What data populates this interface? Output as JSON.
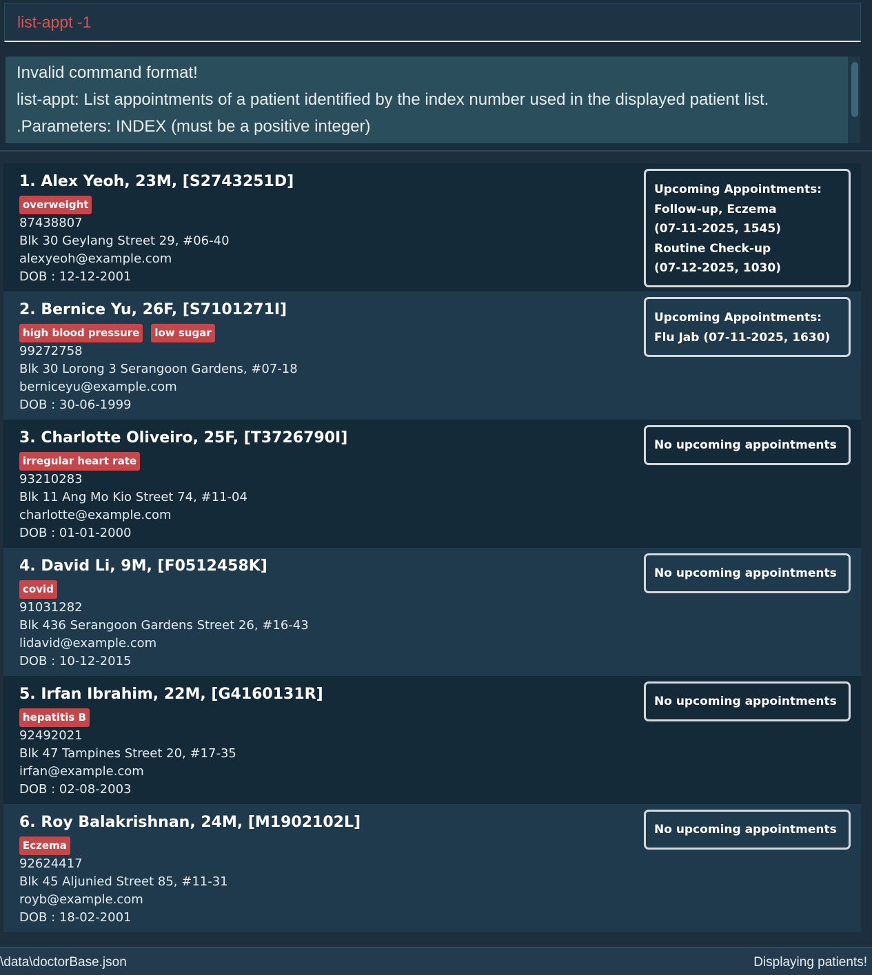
{
  "command": {
    "value": "list-appt -1"
  },
  "result": {
    "lines": [
      "Invalid command format!",
      "list-appt: List appointments of a patient identified by the index number used in the displayed patient list.",
      ".Parameters: INDEX (must be a positive integer)"
    ]
  },
  "patients": [
    {
      "name": "1. Alex Yeoh, 23M, [S2743251D]",
      "tags": [
        "overweight"
      ],
      "phone": "87438807",
      "address": "Blk 30 Geylang Street 29, #06-40",
      "email": "alexyeoh@example.com",
      "dob": "DOB : 12-12-2001",
      "appointments": [
        "Upcoming Appointments:",
        "Follow-up, Eczema",
        "(07-11-2025, 1545)",
        "Routine Check-up",
        "(07-12-2025, 1030)"
      ]
    },
    {
      "name": "2. Bernice Yu, 26F, [S7101271I]",
      "tags": [
        "high blood pressure",
        "low sugar"
      ],
      "phone": "99272758",
      "address": "Blk 30 Lorong 3 Serangoon Gardens, #07-18",
      "email": "berniceyu@example.com",
      "dob": "DOB : 30-06-1999",
      "appointments": [
        "Upcoming Appointments:",
        "Flu Jab (07-11-2025, 1630)"
      ]
    },
    {
      "name": "3. Charlotte Oliveiro, 25F, [T3726790I]",
      "tags": [
        "irregular heart rate"
      ],
      "phone": "93210283",
      "address": "Blk 11 Ang Mo Kio Street 74, #11-04",
      "email": "charlotte@example.com",
      "dob": "DOB : 01-01-2000",
      "appointments": [
        "No upcoming appointments"
      ]
    },
    {
      "name": "4. David Li, 9M, [F0512458K]",
      "tags": [
        "covid"
      ],
      "phone": "91031282",
      "address": "Blk 436 Serangoon Gardens Street 26, #16-43",
      "email": "lidavid@example.com",
      "dob": "DOB : 10-12-2015",
      "appointments": [
        "No upcoming appointments"
      ]
    },
    {
      "name": "5. Irfan Ibrahim, 22M, [G4160131R]",
      "tags": [
        "hepatitis B"
      ],
      "phone": "92492021",
      "address": "Blk 47 Tampines Street 20, #17-35",
      "email": "irfan@example.com",
      "dob": "DOB : 02-08-2003",
      "appointments": [
        "No upcoming appointments"
      ]
    },
    {
      "name": "6. Roy Balakrishnan, 24M, [M1902102L]",
      "tags": [
        "Eczema"
      ],
      "phone": "92624417",
      "address": "Blk 45 Aljunied Street 85, #11-31",
      "email": "royb@example.com",
      "dob": "DOB : 18-02-2001",
      "appointments": [
        "No upcoming appointments"
      ]
    }
  ],
  "status": {
    "path": "\\data\\doctorBase.json",
    "message": "Displaying patients!"
  },
  "colors": {
    "background": "#1d2f3d",
    "command_text": "#d9534f",
    "result_bg": "#2a4e5c",
    "card_dark": "#152a38",
    "card_light": "#1e3a4c",
    "tag": "#c4474c"
  }
}
